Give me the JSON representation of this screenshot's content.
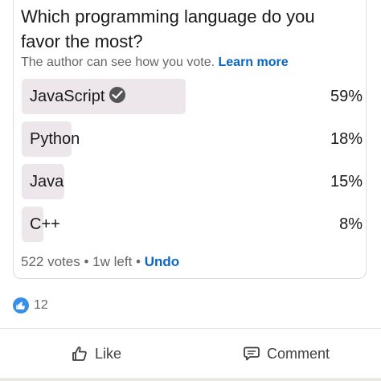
{
  "poll": {
    "question": "Which programming language do you favor the most?",
    "author_note": "The author can see how you vote.",
    "learn_more": "Learn more",
    "options": [
      {
        "label": "JavaScript",
        "percent": "59%",
        "value": 59,
        "selected": true
      },
      {
        "label": "Python",
        "percent": "18%",
        "value": 18,
        "selected": false
      },
      {
        "label": "Java",
        "percent": "15%",
        "value": 15,
        "selected": false
      },
      {
        "label": "C++",
        "percent": "8%",
        "value": 8,
        "selected": false
      }
    ],
    "votes": "522 votes",
    "time_left": "1w left",
    "undo": "Undo"
  },
  "reactions": {
    "icon": "thumbs-up-icon",
    "count": "12"
  },
  "actions": {
    "like": "Like",
    "comment": "Comment"
  },
  "colors": {
    "accent": "#0a66c2",
    "bar_fill": "#ede7ec",
    "reaction_blue": "#378fe9"
  }
}
